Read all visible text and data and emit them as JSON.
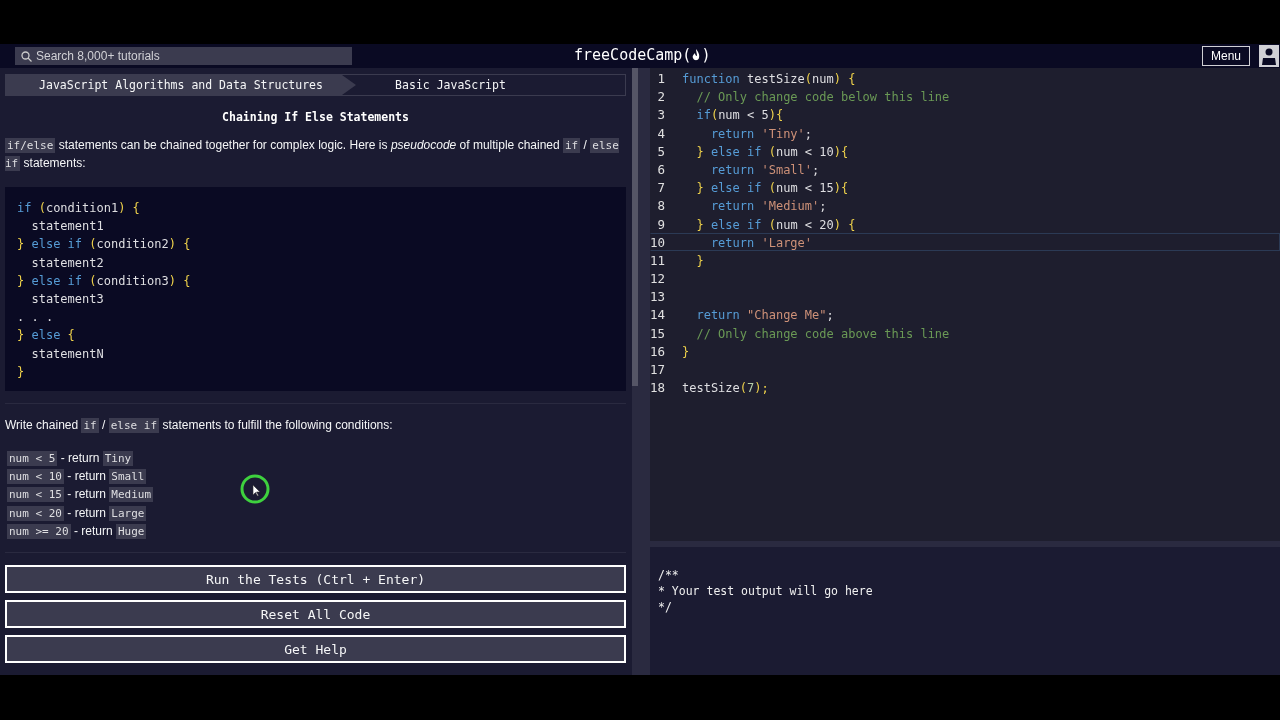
{
  "navbar": {
    "search": {
      "placeholder": "Search 8,000+ tutorials"
    },
    "logo": {
      "before": "freeCodeCamp(",
      "after": ")"
    },
    "menu_button": "Menu"
  },
  "breadcrumb": [
    {
      "label": "JavaScript Algorithms and Data Structures",
      "kind": "superblock"
    },
    {
      "label": "Basic JavaScript",
      "kind": "block"
    }
  ],
  "lesson": {
    "title": "Chaining If Else Statements",
    "intro": [
      {
        "text": "if/else",
        "code": true
      },
      {
        "text": " statements can be chained together for complex logic. Here is *pseudocode* of multiple chained ",
        "code": false
      },
      {
        "text": "if",
        "code": true
      },
      {
        "text": " / ",
        "code": false
      },
      {
        "text": "else if",
        "code": true
      },
      {
        "text": " statements:",
        "code": false
      }
    ],
    "pseudocode": [
      [
        {
          "text": "if",
          "kind": "keyword"
        },
        {
          "text": " (",
          "kind": "bracket"
        },
        {
          "text": "condition1",
          "kind": "plain"
        },
        {
          "text": ") {",
          "kind": "bracket"
        }
      ],
      [
        {
          "text": "  statement1",
          "kind": "plain"
        }
      ],
      [
        {
          "text": "}",
          "kind": "bracket"
        },
        {
          "text": " else if",
          "kind": "keyword"
        },
        {
          "text": " (",
          "kind": "bracket"
        },
        {
          "text": "condition2",
          "kind": "plain"
        },
        {
          "text": ") {",
          "kind": "bracket"
        }
      ],
      [
        {
          "text": "  statement2",
          "kind": "plain"
        }
      ],
      [
        {
          "text": "}",
          "kind": "bracket"
        },
        {
          "text": " else if",
          "kind": "keyword"
        },
        {
          "text": " (",
          "kind": "bracket"
        },
        {
          "text": "condition3",
          "kind": "plain"
        },
        {
          "text": ") {",
          "kind": "bracket"
        }
      ],
      [
        {
          "text": "  statement3",
          "kind": "plain"
        }
      ],
      [
        {
          "text": ". . .",
          "kind": "plain"
        }
      ],
      [
        {
          "text": "}",
          "kind": "bracket"
        },
        {
          "text": " else",
          "kind": "keyword"
        },
        {
          "text": " {",
          "kind": "bracket"
        }
      ],
      [
        {
          "text": "  statementN",
          "kind": "plain"
        }
      ],
      [
        {
          "text": "}",
          "kind": "bracket"
        }
      ]
    ],
    "task": [
      {
        "text": "Write chained ",
        "code": false
      },
      {
        "text": "if",
        "code": true
      },
      {
        "text": " / ",
        "code": false
      },
      {
        "text": "else if",
        "code": true
      },
      {
        "text": " statements to fulfill the following conditions:",
        "code": false
      }
    ],
    "conditions": [
      {
        "condition": "num < 5",
        "word": "- return",
        "result": "Tiny"
      },
      {
        "condition": "num < 10",
        "word": "- return",
        "result": "Small"
      },
      {
        "condition": "num < 15",
        "word": "- return",
        "result": "Medium"
      },
      {
        "condition": "num < 20",
        "word": "- return",
        "result": "Large"
      },
      {
        "condition": "num >= 20",
        "word": "- return",
        "result": "Huge"
      }
    ],
    "buttons": [
      "Run the Tests (Ctrl + Enter)",
      "Reset All Code",
      "Get Help"
    ]
  },
  "editor": {
    "lines": [
      {
        "number": "1",
        "active": false,
        "tokens": [
          {
            "text": "function",
            "kind": "keyword"
          },
          {
            "text": " testSize",
            "kind": "plain"
          },
          {
            "text": "(",
            "kind": "bracket"
          },
          {
            "text": "num",
            "kind": "plain"
          },
          {
            "text": ") {",
            "kind": "bracket"
          }
        ]
      },
      {
        "number": "2",
        "active": false,
        "tokens": [
          {
            "text": "  // Only change code below this line",
            "kind": "comment"
          }
        ]
      },
      {
        "number": "3",
        "active": false,
        "tokens": [
          {
            "text": "  if",
            "kind": "keyword"
          },
          {
            "text": "(",
            "kind": "bracket"
          },
          {
            "text": "num < 5",
            "kind": "plain"
          },
          {
            "text": "){",
            "kind": "bracket"
          }
        ]
      },
      {
        "number": "4",
        "active": false,
        "tokens": [
          {
            "text": "    return",
            "kind": "keyword"
          },
          {
            "text": " 'Tiny'",
            "kind": "string"
          },
          {
            "text": ";",
            "kind": "plain"
          }
        ]
      },
      {
        "number": "5",
        "active": false,
        "tokens": [
          {
            "text": "  }",
            "kind": "bracket"
          },
          {
            "text": " else if",
            "kind": "keyword"
          },
          {
            "text": " (",
            "kind": "bracket"
          },
          {
            "text": "num < 10",
            "kind": "plain"
          },
          {
            "text": "){",
            "kind": "bracket"
          }
        ]
      },
      {
        "number": "6",
        "active": false,
        "tokens": [
          {
            "text": "    return",
            "kind": "keyword"
          },
          {
            "text": " 'Small'",
            "kind": "string"
          },
          {
            "text": ";",
            "kind": "plain"
          }
        ]
      },
      {
        "number": "7",
        "active": false,
        "tokens": [
          {
            "text": "  }",
            "kind": "bracket"
          },
          {
            "text": " else if",
            "kind": "keyword"
          },
          {
            "text": " (",
            "kind": "bracket"
          },
          {
            "text": "num < 15",
            "kind": "plain"
          },
          {
            "text": "){",
            "kind": "bracket"
          }
        ]
      },
      {
        "number": "8",
        "active": false,
        "tokens": [
          {
            "text": "    return",
            "kind": "keyword"
          },
          {
            "text": " 'Medium'",
            "kind": "string"
          },
          {
            "text": ";",
            "kind": "plain"
          }
        ]
      },
      {
        "number": "9",
        "active": false,
        "tokens": [
          {
            "text": "  }",
            "kind": "bracket"
          },
          {
            "text": " else if",
            "kind": "keyword"
          },
          {
            "text": " (",
            "kind": "bracket"
          },
          {
            "text": "num < 20",
            "kind": "plain"
          },
          {
            "text": ") {",
            "kind": "bracket"
          }
        ]
      },
      {
        "number": "10",
        "active": true,
        "tokens": [
          {
            "text": "    return",
            "kind": "keyword"
          },
          {
            "text": " 'Large'",
            "kind": "string"
          }
        ]
      },
      {
        "number": "11",
        "active": false,
        "tokens": [
          {
            "text": "  }",
            "kind": "bracket"
          }
        ]
      },
      {
        "number": "12",
        "active": false
      },
      {
        "number": "13",
        "active": false
      },
      {
        "number": "14",
        "active": false,
        "tokens": [
          {
            "text": "  return",
            "kind": "keyword"
          },
          {
            "text": " \"Change Me\"",
            "kind": "string"
          },
          {
            "text": ";",
            "kind": "plain"
          }
        ]
      },
      {
        "number": "15",
        "active": false,
        "tokens": [
          {
            "text": "  // Only change code above this line",
            "kind": "comment"
          }
        ]
      },
      {
        "number": "16",
        "active": false,
        "tokens": [
          {
            "text": "}",
            "kind": "bracket"
          }
        ]
      },
      {
        "number": "17",
        "active": false
      },
      {
        "number": "18",
        "active": false,
        "tokens": [
          {
            "text": "testSize",
            "kind": "plain"
          },
          {
            "text": "(",
            "kind": "bracket"
          },
          {
            "text": "7",
            "kind": "number"
          },
          {
            "text": ");",
            "kind": "bracket"
          }
        ]
      }
    ]
  },
  "output": [
    "/**",
    "* Your test output will go here",
    "*/"
  ]
}
